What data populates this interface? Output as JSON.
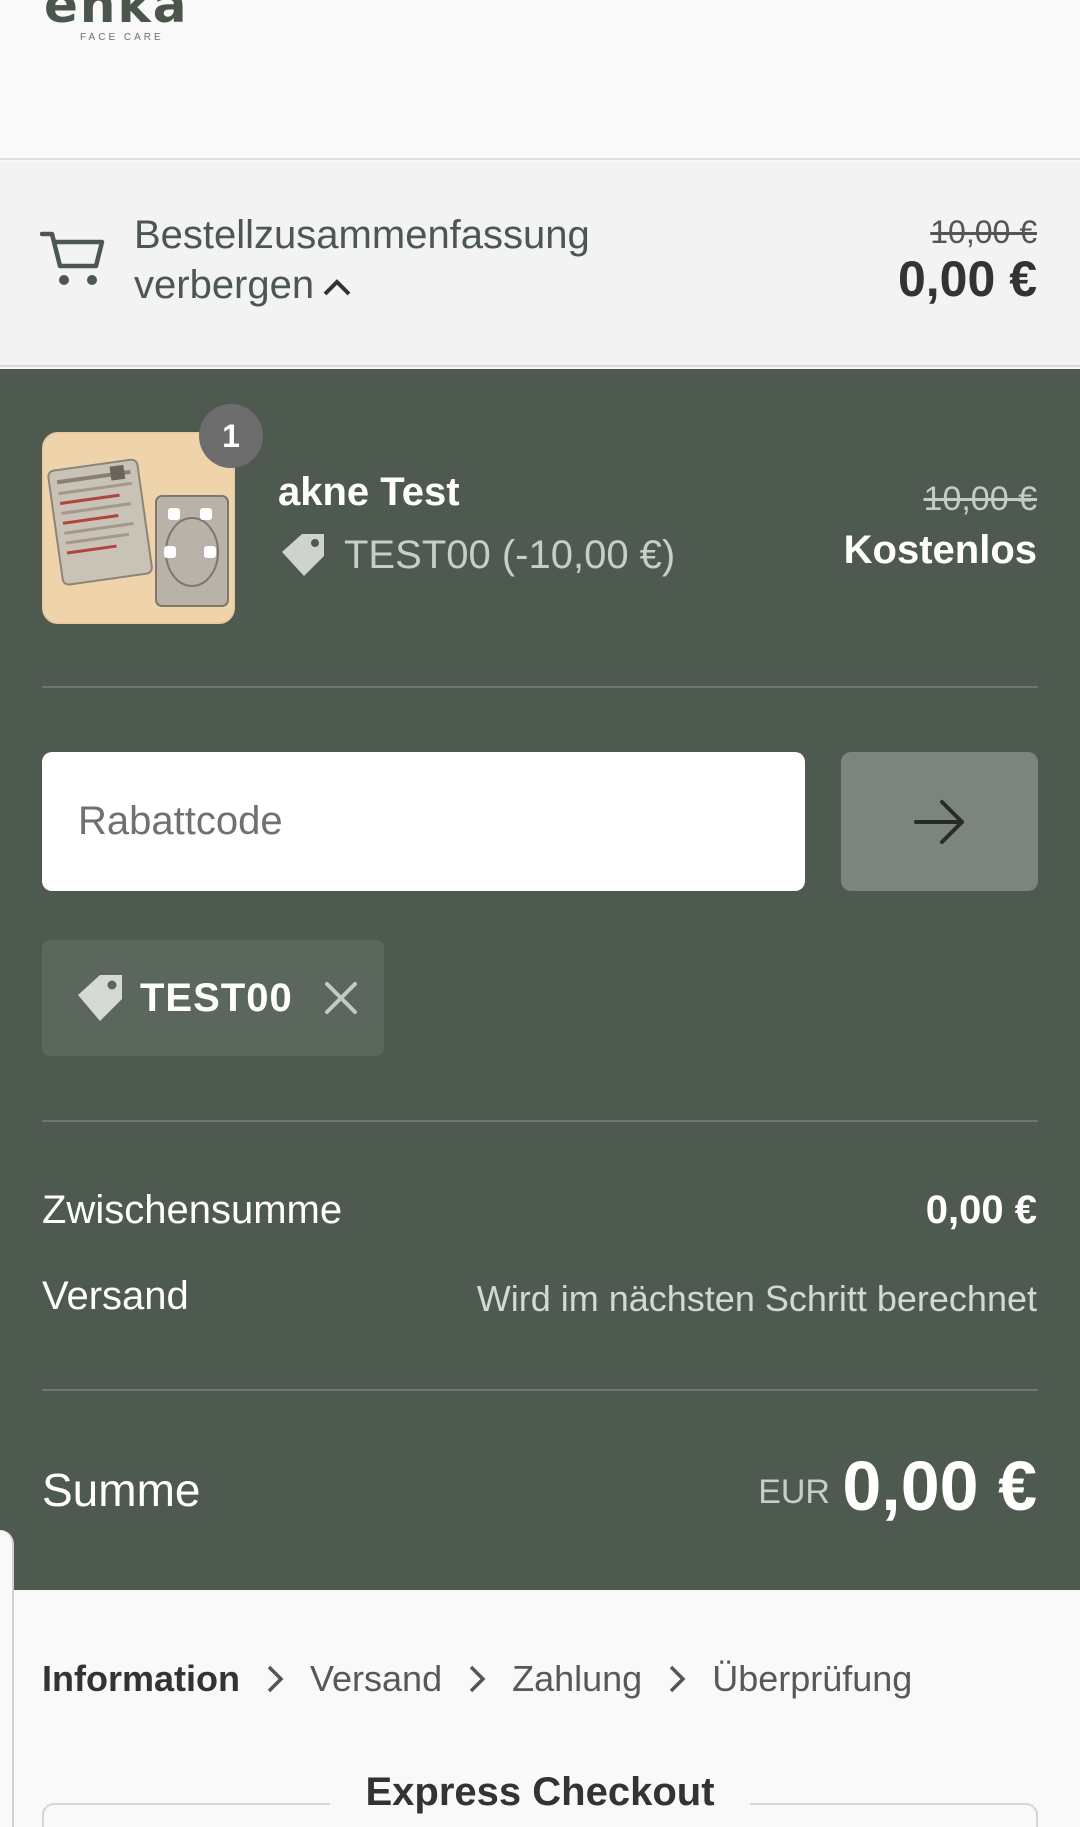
{
  "brand": {
    "name": "enka",
    "tagline": "FACE CARE"
  },
  "summary_toggle": {
    "label": "Bestellzusammenfassung verbergen",
    "old_price": "10,00 €",
    "price": "0,00 €"
  },
  "line_item": {
    "quantity": "1",
    "name": "akne Test",
    "discount": "TEST00 (-10,00 €)",
    "old_price": "10,00 €",
    "price": "Kostenlos"
  },
  "discount_form": {
    "placeholder": "Rabattcode",
    "applied_code": "TEST00"
  },
  "totals": {
    "subtotal_label": "Zwischensumme",
    "subtotal_value": "0,00 €",
    "shipping_label": "Versand",
    "shipping_value": "Wird im nächsten Schritt berechnet",
    "total_label": "Summe",
    "currency": "EUR",
    "total_value": "0,00 €"
  },
  "breadcrumb": [
    {
      "label": "Information",
      "active": true
    },
    {
      "label": "Versand",
      "active": false
    },
    {
      "label": "Zahlung",
      "active": false
    },
    {
      "label": "Überprüfung",
      "active": false
    }
  ],
  "express": {
    "title": "Express Checkout"
  },
  "colors": {
    "panel_bg": "#4e5a50",
    "apply_button": "#7b857d",
    "chip_bg": "#5b665d"
  }
}
